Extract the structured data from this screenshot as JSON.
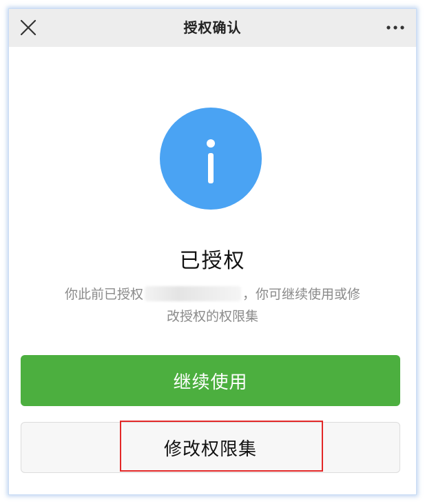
{
  "header": {
    "title": "授权确认",
    "close_icon": "close-icon",
    "more_icon": "more-icon"
  },
  "status": {
    "icon": "info-icon",
    "icon_color": "#4aa3f3",
    "heading": "已授权",
    "desc_prefix": "你此前已授权",
    "desc_suffix": "，你可继续使用或修",
    "desc_line2": "改授权的权限集"
  },
  "actions": {
    "continue_label": "继续使用",
    "continue_color": "#4caf3f",
    "modify_label": "修改权限集"
  },
  "annotation": {
    "highlight_color": "#e32828"
  }
}
